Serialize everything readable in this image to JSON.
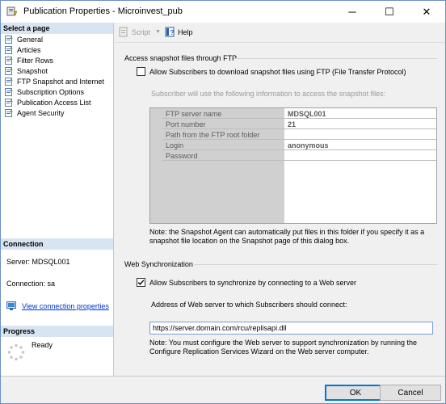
{
  "window": {
    "title": "Publication Properties - Microinvest_pub",
    "minimize": "─",
    "maximize": "☐",
    "close": "✕"
  },
  "left": {
    "select_page_header": "Select a page",
    "pages": [
      {
        "label": "General",
        "icon": "page-icon"
      },
      {
        "label": "Articles",
        "icon": "page-icon"
      },
      {
        "label": "Filter Rows",
        "icon": "page-icon"
      },
      {
        "label": "Snapshot",
        "icon": "page-icon"
      },
      {
        "label": "FTP Snapshot and Internet",
        "icon": "page-icon"
      },
      {
        "label": "Subscription Options",
        "icon": "page-icon"
      },
      {
        "label": "Publication Access List",
        "icon": "page-icon"
      },
      {
        "label": "Agent Security",
        "icon": "page-icon"
      }
    ],
    "connection_header": "Connection",
    "server_label": "Server: MDSQL001",
    "connection_label": "Connection: sa",
    "view_connection_link": "View connection properties",
    "progress_header": "Progress",
    "progress_status": "Ready"
  },
  "toolbar": {
    "script_label": "Script",
    "help_label": "Help"
  },
  "ftp": {
    "section_label": "Access snapshot files through FTP",
    "allow_checkbox_label": "Allow Subscribers to download snapshot files using FTP (File Transfer Protocol)",
    "allow_checked": false,
    "info_text": "Subscriber will use the following information to access the snapshot files:",
    "grid": [
      {
        "key": "FTP server name",
        "value": "MDSQL001"
      },
      {
        "key": "Port number",
        "value": "21"
      },
      {
        "key": "Path from the FTP root folder",
        "value": ""
      },
      {
        "key": "Login",
        "value": "anonymous"
      },
      {
        "key": "Password",
        "value": ""
      }
    ],
    "note_line1": "Note: the Snapshot Agent can automatically put files in this folder if you specify it as a",
    "note_line2": "snapshot file location on the Snapshot page of this dialog box."
  },
  "web": {
    "section_label": "Web Synchronization",
    "allow_checkbox_label": "Allow Subscribers to synchronize by connecting to a Web server",
    "allow_checked": true,
    "address_label": "Address of Web server to which Subscribers should connect:",
    "address_value": "https://server.domain.com/rcu/replisapi.dll",
    "note_line1": "Note: You must configure the Web server to support synchronization by running the",
    "note_line2": "Configure Replication Services Wizard on the Web server computer."
  },
  "footer": {
    "ok_label": "OK",
    "cancel_label": "Cancel"
  },
  "colors": {
    "header_bg": "#d7e4f2",
    "link": "#0033cc",
    "grid_key_bg": "#d0d0d0",
    "default_button_border": "#0078d7"
  }
}
